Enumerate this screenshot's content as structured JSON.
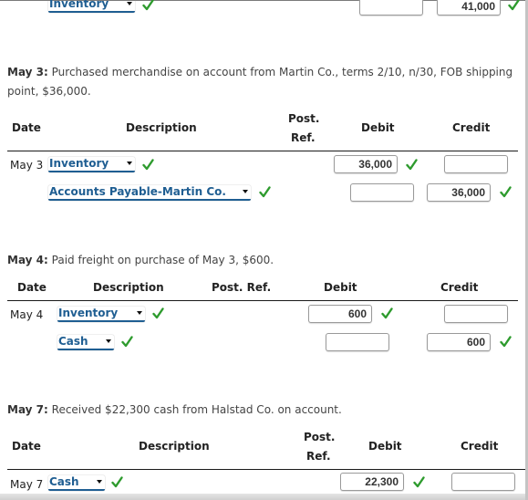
{
  "prev_entry": {
    "row": {
      "account": "Inventory",
      "checked": true,
      "debit": "",
      "credit": "41,000",
      "credit_checked": true
    }
  },
  "may3": {
    "prompt_label": "May 3:",
    "prompt_text": " Purchased merchandise on account from Martin Co., terms 2/10, n/30, FOB shipping point, $36,000.",
    "headers": {
      "date": "Date",
      "description": "Description",
      "post_ref_line1": "Post.",
      "post_ref_line2": "Ref.",
      "debit": "Debit",
      "credit": "Credit"
    },
    "rows": [
      {
        "date": "May 3",
        "account": "Inventory",
        "debit": "36,000",
        "credit": ""
      },
      {
        "date": "",
        "account": "Accounts Payable-Martin Co.",
        "debit": "",
        "credit": "36,000"
      }
    ]
  },
  "may4": {
    "prompt_label": "May 4:",
    "prompt_text": " Paid freight on purchase of May 3, $600.",
    "headers": {
      "date": "Date",
      "description": "Description",
      "post_ref": "Post. Ref.",
      "debit": "Debit",
      "credit": "Credit"
    },
    "rows": [
      {
        "date": "May 4",
        "account": "Inventory",
        "debit": "600",
        "credit": ""
      },
      {
        "date": "",
        "account": "Cash",
        "debit": "",
        "credit": "600"
      }
    ]
  },
  "may7": {
    "prompt_label": "May 7:",
    "prompt_text": " Received $22,300 cash from Halstad Co. on account.",
    "headers": {
      "date": "Date",
      "description": "Description",
      "post_ref_line1": "Post.",
      "post_ref_line2": "Ref.",
      "debit": "Debit",
      "credit": "Credit"
    },
    "rows": [
      {
        "date": "May 7",
        "account": "Cash",
        "debit": "22,300",
        "credit": ""
      }
    ]
  },
  "colors": {
    "link": "#1f5e92",
    "check": "#2e9b2e",
    "rule": "#1a1a1a"
  }
}
